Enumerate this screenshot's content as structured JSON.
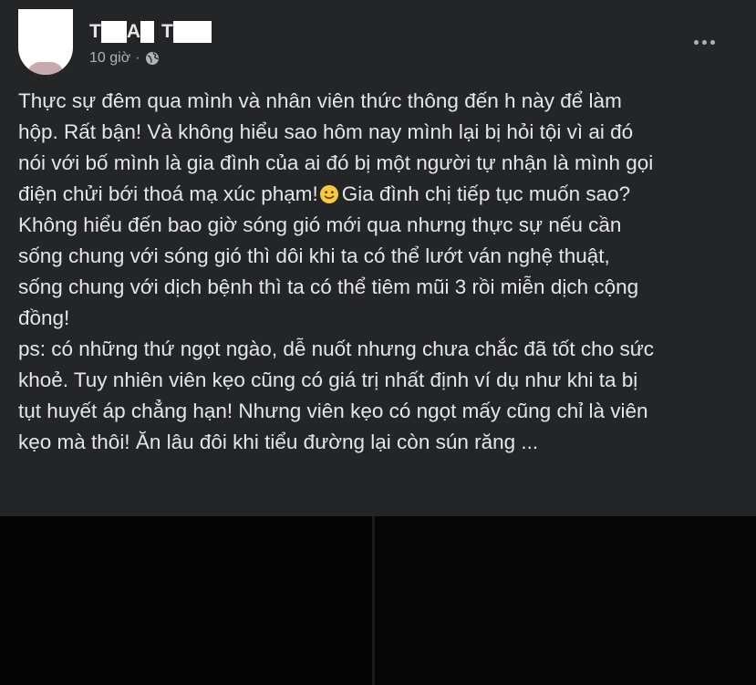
{
  "post": {
    "author_parts": [
      "T",
      "A",
      "T"
    ],
    "timestamp": "10 giờ",
    "separator": "·",
    "audience_icon": "globe-icon",
    "menu_icon": "more-horizontal-icon",
    "body_lines": [
      "Thực sự đêm qua mình và nhân viên thức thông đến h này để làm",
      "hộp. Rất bận! Và không hiểu sao hôm nay mình lại bị hỏi tội vì ai đó",
      "nói với bố mình là gia đình của ai đó bị một người tự nhận là mình gọi",
      "điện chửi bới thoá mạ xúc phạm!",
      "Gia đình chị tiếp tục muốn sao?",
      "Không hiểu đến bao giờ sóng gió mới qua nhưng thực sự nếu cần",
      "sống chung với sóng gió thì dôi khi ta có thể lướt ván nghệ thuật,",
      "sống chung với dịch bệnh thì ta có thể tiêm mũi 3 rồi miễn dịch cộng",
      "đồng!",
      "ps: có những thứ ngọt ngào, dễ nuốt nhưng chưa chắc đã tốt cho sức",
      "khoẻ. Tuy nhiên viên kẹo cũng có giá trị nhất định ví dụ như khi ta bị",
      "tụt huyết áp chẳng hạn! Nhưng viên kẹo có ngọt mấy cũng chỉ là viên",
      "kẹo mà thôi! Ăn lâu đôi khi tiểu đường lại còn sún răng ..."
    ],
    "emoji": "slightly-smiling-face-icon"
  },
  "colors": {
    "background": "#242526",
    "text_primary": "#e4e6eb",
    "text_secondary": "#b0b3b8",
    "emoji": "#f7c93e"
  }
}
